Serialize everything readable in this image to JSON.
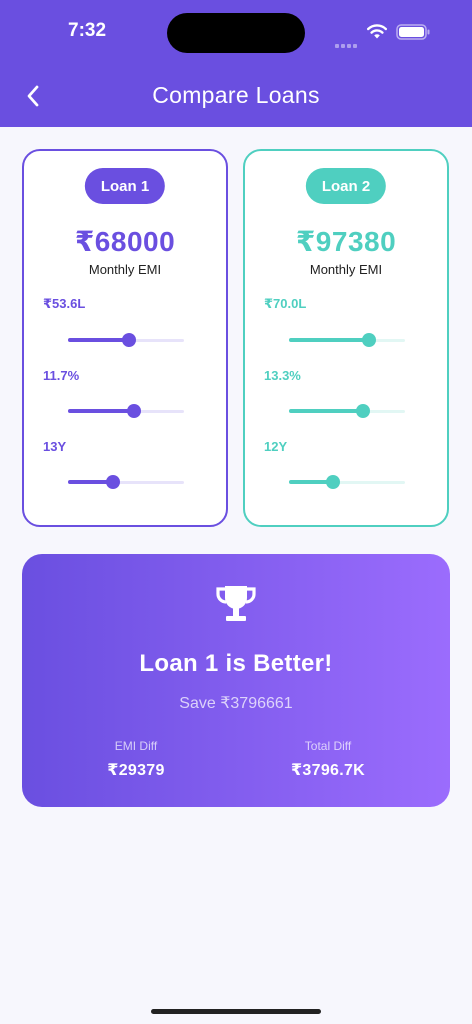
{
  "status_bar": {
    "time": "7:32"
  },
  "header": {
    "title": "Compare Loans"
  },
  "loans": [
    {
      "badge": "Loan 1",
      "emi": "₹68000",
      "emi_label": "Monthly EMI",
      "color": "#6a4fe0",
      "sliders": [
        {
          "label": "₹53.6L",
          "value_fraction": 0.53
        },
        {
          "label": "11.7%",
          "value_fraction": 0.57
        },
        {
          "label": "13Y",
          "value_fraction": 0.39
        }
      ]
    },
    {
      "badge": "Loan 2",
      "emi": "₹97380",
      "emi_label": "Monthly EMI",
      "color": "#4fcfc0",
      "sliders": [
        {
          "label": "₹70.0L",
          "value_fraction": 0.69
        },
        {
          "label": "13.3%",
          "value_fraction": 0.64
        },
        {
          "label": "12Y",
          "value_fraction": 0.38
        }
      ]
    }
  ],
  "result": {
    "icon": "trophy-icon",
    "title": "Loan 1 is Better!",
    "save": "Save ₹3796661",
    "emi_diff_label": "EMI Diff",
    "emi_diff_value": "₹29379",
    "total_diff_label": "Total Diff",
    "total_diff_value": "₹3796.7K"
  }
}
